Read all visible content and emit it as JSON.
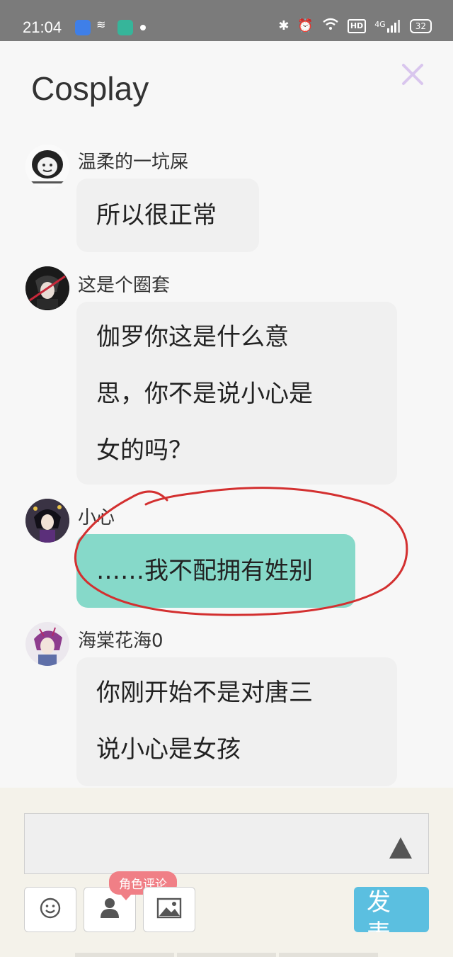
{
  "status_bar": {
    "time": "21:04",
    "app_icon_2_glyph": "≋",
    "hd_label": "HD",
    "network": "4G",
    "battery": "32"
  },
  "header": {
    "title": "Cosplay"
  },
  "messages": [
    {
      "user": "温柔的一坑屎",
      "text": "所以很正常",
      "style": "gray"
    },
    {
      "user": "这是个圈套",
      "text_lines": [
        "伽罗你这是什么意",
        "思，你不是说小心是",
        "女的吗？"
      ],
      "style": "gray"
    },
    {
      "user": "小心",
      "text": "……我不配拥有姓别",
      "style": "teal"
    },
    {
      "user": "海棠花海0",
      "text_lines": [
        "你刚开始不是对唐三",
        "说小心是女孩"
      ],
      "style": "gray"
    }
  ],
  "composer": {
    "role_comment_tag": "角色评论",
    "publish_label_line1": "发",
    "publish_label_line2": "表"
  },
  "colors": {
    "status_bar": "#7b7b7b",
    "bubble_gray": "#f0f0f0",
    "bubble_teal": "#86d9c9",
    "annotation_red": "#d33030",
    "publish_button": "#5bbfe0",
    "role_tag": "#f07f86",
    "close_icon": "#d9c6ee"
  }
}
